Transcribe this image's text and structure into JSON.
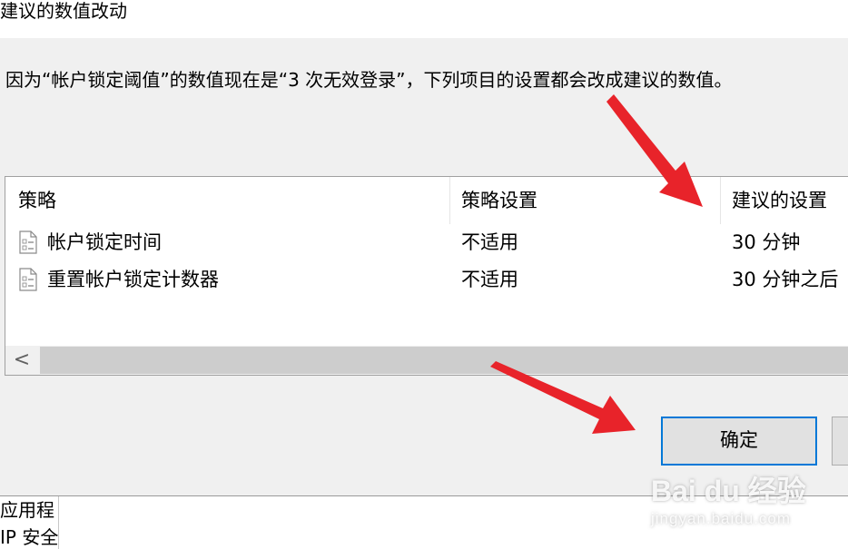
{
  "dialog": {
    "title": "建议的数值改动",
    "message": "因为“帐户锁定阈值”的数值现在是“3 次无效登录”，下列项目的设置都会改成建议的数值。",
    "ok_label": "确定",
    "cancel_label": ""
  },
  "table": {
    "columns": [
      "策略",
      "策略设置",
      "建议的设置"
    ],
    "rows": [
      {
        "policy": "帐户锁定时间",
        "setting": "不适用",
        "suggested": "30 分钟",
        "icon": "policy-icon"
      },
      {
        "policy": "重置帐户锁定计数器",
        "setting": "不适用",
        "suggested": "30 分钟之后",
        "icon": "policy-icon"
      }
    ],
    "scroll_left_arrow": "<"
  },
  "background_window": {
    "lines": [
      "应用程",
      "IP 安全"
    ]
  },
  "watermark": {
    "main": "Bai du 经验",
    "sub": "jingyan.baidu.com"
  },
  "colors": {
    "annotation_arrow": "#e8232a",
    "ok_focus": "#0078d7"
  }
}
